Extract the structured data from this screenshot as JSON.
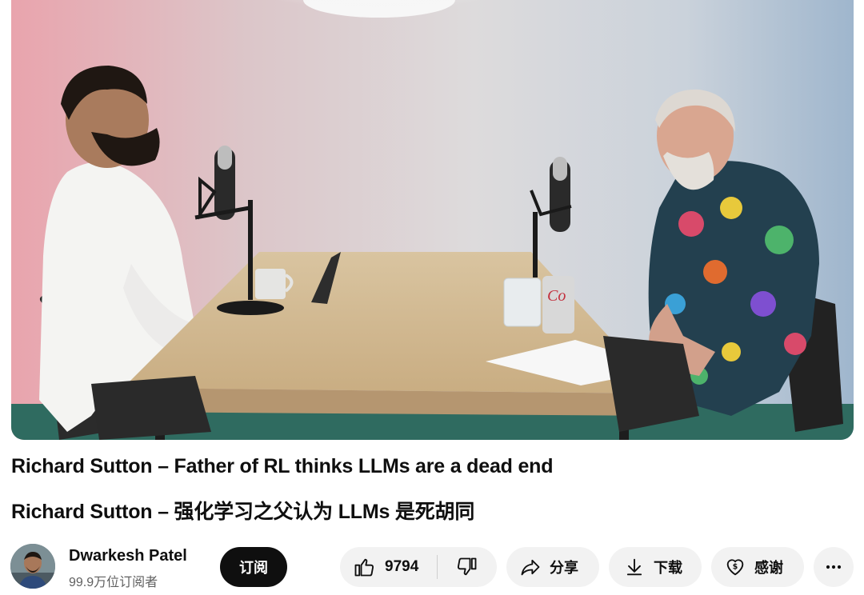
{
  "video": {
    "title_en": "Richard Sutton – Father of RL thinks LLMs are a dead end",
    "title_zh": "Richard Sutton – 强化学习之父认为 LLMs 是死胡同",
    "can_label": "Co"
  },
  "channel": {
    "name": "Dwarkesh Patel",
    "subscribers": "99.9万位订阅者",
    "subscribe_label": "订阅"
  },
  "actions": {
    "like_count": "9794",
    "like_icon": "thumbs-up-icon",
    "dislike_icon": "thumbs-down-icon",
    "share_label": "分享",
    "share_icon": "share-arrow-icon",
    "download_label": "下载",
    "download_icon": "download-arrow-icon",
    "thanks_label": "感谢",
    "thanks_icon": "heart-dollar-icon",
    "more_icon": "more-horizontal-icon"
  },
  "colors": {
    "primary_text": "#0f0f0f",
    "secondary_text": "#606060",
    "subscribe_bg": "#0f0f0f",
    "pill_bg": "#f2f2f2"
  }
}
